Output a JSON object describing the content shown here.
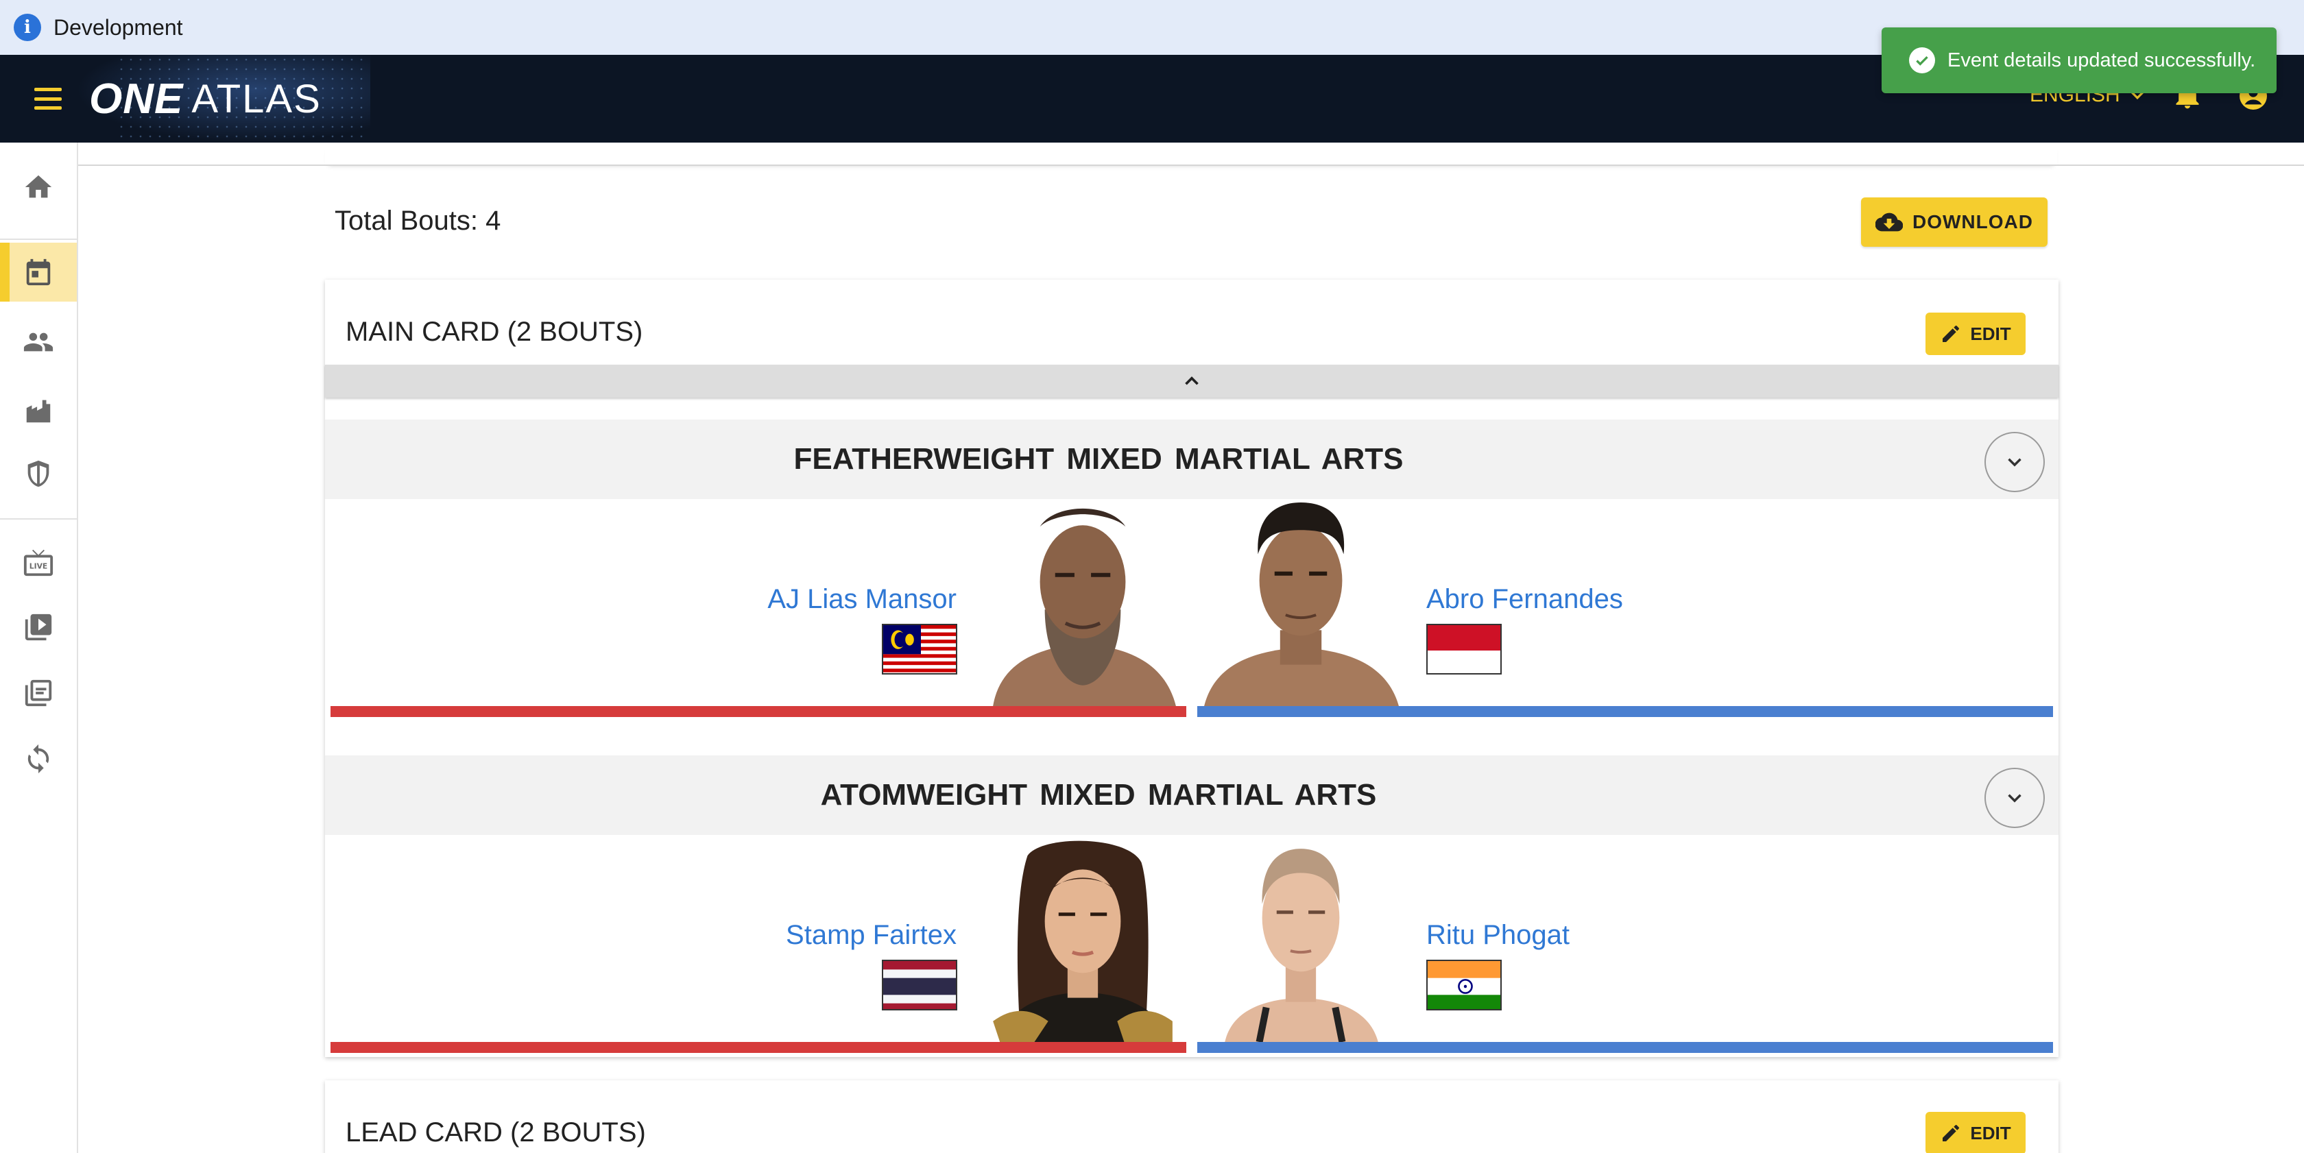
{
  "env": {
    "label": "Development"
  },
  "header": {
    "logo_one": "ONE",
    "logo_atlas": "ATLAS",
    "language": "ENGLISH"
  },
  "toast": {
    "message": "Event details updated successfully."
  },
  "sidebar": {
    "items": [
      {
        "icon": "home-icon"
      },
      {
        "icon": "calendar-icon",
        "active": true
      },
      {
        "icon": "people-icon"
      },
      {
        "icon": "buildings-icon"
      },
      {
        "icon": "shield-icon"
      },
      {
        "icon": "live-tv-icon"
      },
      {
        "icon": "video-library-icon"
      },
      {
        "icon": "photo-library-icon"
      },
      {
        "icon": "sync-icon"
      }
    ]
  },
  "summary": {
    "total_bouts": "Total Bouts: 4",
    "download_label": "DOWNLOAD"
  },
  "cards": [
    {
      "title": "MAIN CARD (2 BOUTS)",
      "edit_label": "EDIT",
      "bouts": [
        {
          "title": "FEATHERWEIGHT MIXED MARTIAL ARTS",
          "red": {
            "name": "AJ Lias Mansor",
            "country_flag": "malaysia-flag"
          },
          "blue": {
            "name": "Abro Fernandes",
            "country_flag": "indonesia-flag"
          }
        },
        {
          "title": "ATOMWEIGHT MIXED MARTIAL ARTS",
          "red": {
            "name": "Stamp Fairtex",
            "country_flag": "thailand-flag"
          },
          "blue": {
            "name": "Ritu Phogat",
            "country_flag": "india-flag"
          }
        }
      ]
    },
    {
      "title": "LEAD CARD (2 BOUTS)",
      "edit_label": "EDIT"
    }
  ],
  "colors": {
    "accent": "#f5cd2e",
    "header_bg": "#0c1524",
    "red_corner": "#d63b3b",
    "blue_corner": "#4a7fd0",
    "link": "#2f78d4",
    "toast_bg": "#46a04a"
  }
}
